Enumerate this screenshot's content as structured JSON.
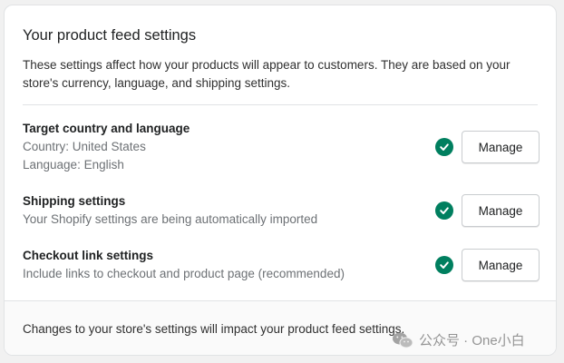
{
  "card": {
    "title": "Your product feed settings",
    "description": "These settings affect how your products will appear to customers. They are based on your store's currency, language, and shipping settings."
  },
  "rows": [
    {
      "name": "Target country and language",
      "sub": [
        "Country: United States",
        "Language: English"
      ],
      "status_icon": "check-circle-icon",
      "button_label": "Manage"
    },
    {
      "name": "Shipping settings",
      "sub": [
        "Your Shopify settings are being automatically imported"
      ],
      "status_icon": "check-circle-icon",
      "button_label": "Manage"
    },
    {
      "name": "Checkout link settings",
      "sub": [
        "Include links to checkout and product page (recommended)"
      ],
      "status_icon": "check-circle-icon",
      "button_label": "Manage"
    }
  ],
  "footer": {
    "note": "Changes to your store's settings will impact your product feed settings."
  },
  "watermark": {
    "text": "公众号 · One小白",
    "icon": "wechat-icon"
  },
  "colors": {
    "success": "#007f5f",
    "text": "#202223",
    "subdued": "#6d7175"
  }
}
